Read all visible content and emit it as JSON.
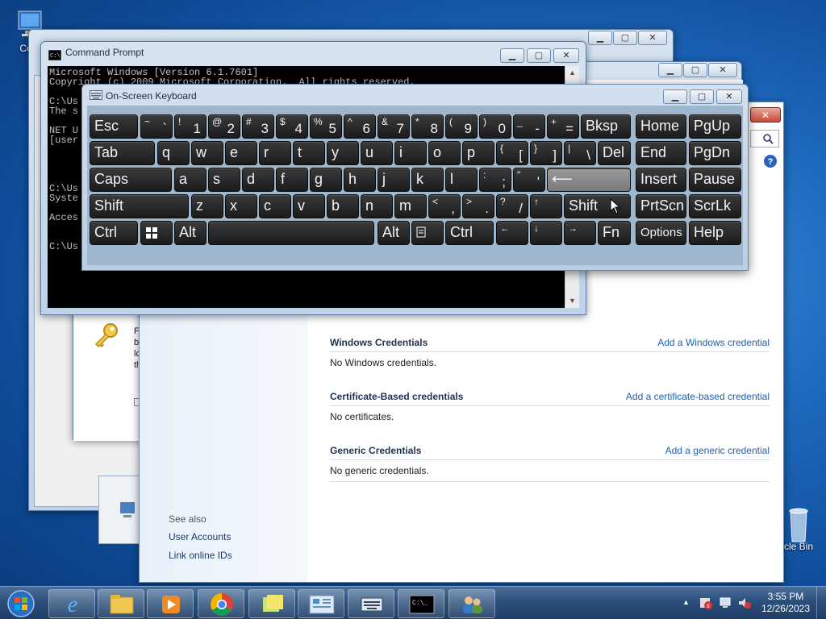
{
  "desktop": {
    "computer_icon_label": "Com",
    "recycle_bin_label": "cle Bin"
  },
  "cmd": {
    "title": "Command Prompt",
    "lines": [
      "Microsoft Windows [Version 6.1.7601]",
      "Copyright (c) 2009 Microsoft Corporation.  All rights reserved.",
      "",
      "C:\\Us",
      "The s",
      "",
      "NET U",
      "[user",
      "",
      "",
      "",
      "",
      "C:\\Us",
      "Syste",
      "",
      "Acces",
      "",
      "",
      "C:\\Us"
    ]
  },
  "osk": {
    "title": "On-Screen Keyboard",
    "keys": {
      "esc": "Esc",
      "bksp": "Bksp",
      "home": "Home",
      "pgup": "PgUp",
      "tab": "Tab",
      "del": "Del",
      "end": "End",
      "pgdn": "PgDn",
      "caps": "Caps",
      "insert": "Insert",
      "pause": "Pause",
      "shift": "Shift",
      "prtscn": "PrtScn",
      "scrlk": "ScrLk",
      "ctrl": "Ctrl",
      "alt": "Alt",
      "fn": "Fn",
      "options": "Options",
      "help": "Help",
      "row1": [
        {
          "s": "~",
          "b": "`"
        },
        {
          "s": "!",
          "b": "1"
        },
        {
          "s": "@",
          "b": "2"
        },
        {
          "s": "#",
          "b": "3"
        },
        {
          "s": "$",
          "b": "4"
        },
        {
          "s": "%",
          "b": "5"
        },
        {
          "s": "^",
          "b": "6"
        },
        {
          "s": "&",
          "b": "7"
        },
        {
          "s": "*",
          "b": "8"
        },
        {
          "s": "(",
          "b": "9"
        },
        {
          "s": ")",
          "b": "0"
        },
        {
          "s": "_",
          "b": "-"
        },
        {
          "s": "+",
          "b": "="
        }
      ],
      "row2": [
        "q",
        "w",
        "e",
        "r",
        "t",
        "y",
        "u",
        "i",
        "o",
        "p"
      ],
      "row2_sym": [
        {
          "s": "{",
          "b": "["
        },
        {
          "s": "}",
          "b": "]"
        },
        {
          "s": "|",
          "b": "\\"
        }
      ],
      "row3": [
        "a",
        "s",
        "d",
        "f",
        "g",
        "h",
        "j",
        "k",
        "l"
      ],
      "row3_sym": [
        {
          "s": ":",
          "b": ";"
        },
        {
          "s": "\"",
          "b": "'"
        }
      ],
      "row4": [
        "z",
        "x",
        "c",
        "v",
        "b",
        "n",
        "m"
      ],
      "row4_sym": [
        {
          "s": "<",
          "b": ","
        },
        {
          "s": ">",
          "b": "."
        },
        {
          "s": "?",
          "b": "/"
        }
      ],
      "arrow_up": "↑",
      "arrow_left": "←",
      "arrow_down": "↓",
      "arrow_right": "→",
      "enter_glyph": "⟵"
    }
  },
  "credman": {
    "sections": [
      {
        "title": "Windows Credentials",
        "link": "Add a Windows credential",
        "text": "No Windows credentials."
      },
      {
        "title": "Certificate-Based credentials",
        "link": "Add a certificate-based credential",
        "text": "No certificates."
      },
      {
        "title": "Generic Credentials",
        "link": "Add a generic credential",
        "text": "No generic credentials."
      }
    ],
    "see_also": "See also",
    "links": [
      "User Accounts",
      "Link online IDs"
    ]
  },
  "bg_dialog": {
    "text_fragments": [
      "F",
      "b",
      "lo",
      "th"
    ]
  },
  "taskbar": {
    "time": "3:55 PM",
    "date": "12/26/2023"
  }
}
